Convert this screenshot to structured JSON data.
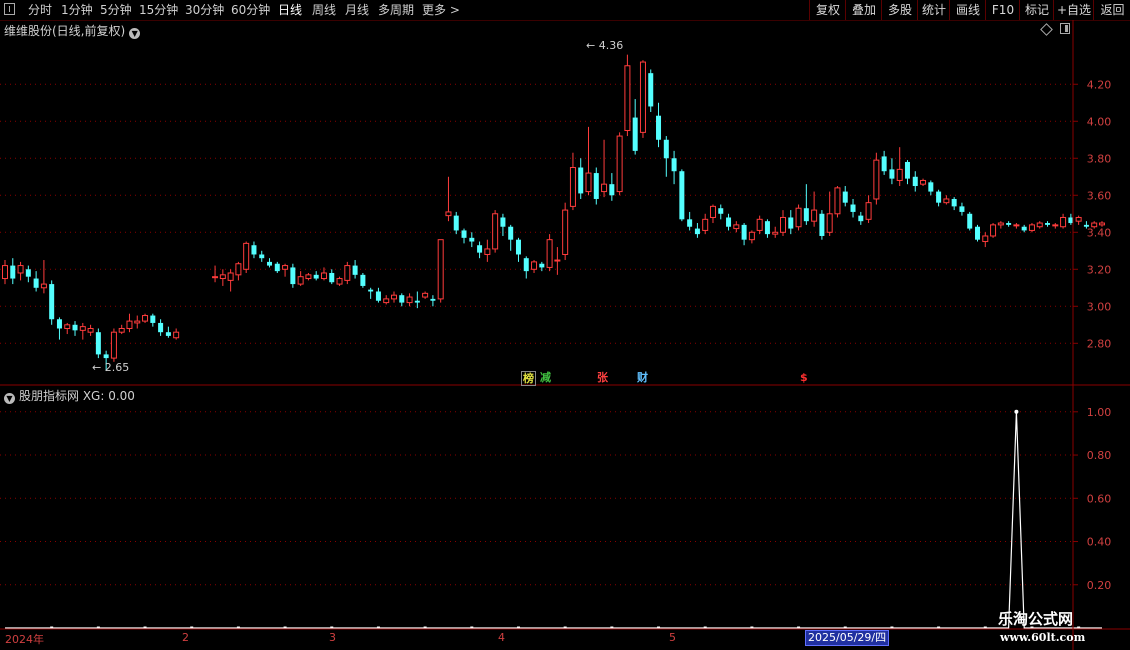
{
  "toolbar": {
    "periods": [
      {
        "label": "分时",
        "x": 0
      },
      {
        "label": "1分钟"
      },
      {
        "label": "5分钟"
      },
      {
        "label": "15分钟"
      },
      {
        "label": "30分钟"
      },
      {
        "label": "60分钟"
      },
      {
        "label": "日线"
      },
      {
        "label": "周线"
      },
      {
        "label": "月线"
      },
      {
        "label": "多周期"
      },
      {
        "label": "更多 >"
      }
    ],
    "active_period": "日线",
    "right_buttons": [
      "复权",
      "叠加",
      "多股",
      "统计",
      "画线",
      "F10",
      "标记",
      "+自选",
      "返回"
    ]
  },
  "main": {
    "title": "维维股份(日线,前复权)",
    "high_label": "4.36",
    "low_label": "2.65",
    "tags": [
      {
        "text": "榜",
        "color": "#e0e040"
      },
      {
        "text": "减",
        "color": "#40c040"
      },
      {
        "text": "张",
        "color": "#ff4040"
      },
      {
        "text": "财",
        "color": "#60c0ff"
      },
      {
        "text": "$",
        "color": "#ff3030"
      }
    ]
  },
  "indicator": {
    "title": "股朋指标网 XG: 0.00"
  },
  "dates": {
    "year": "2024年",
    "months": [
      "2",
      "3",
      "4",
      "5"
    ],
    "selected": "2025/05/29/四"
  },
  "watermark": {
    "title": "乐淘公式网",
    "url": "www.60lt.com"
  },
  "colors": {
    "up": "#ff3c3c",
    "down": "#54ffff",
    "grid": "#8a0000",
    "axis_text": "#d04040",
    "signal_line": "#ffffff"
  },
  "chart_data": [
    {
      "type": "candlestick",
      "title": "维维股份(日线,前复权)",
      "y_ticks": [
        2.8,
        3.0,
        3.2,
        3.4,
        3.6,
        3.8,
        4.0,
        4.2
      ],
      "ylim": [
        2.58,
        4.45
      ],
      "candles": [
        [
          3.15,
          3.22,
          3.25,
          3.12
        ],
        [
          3.22,
          3.15,
          3.26,
          3.12
        ],
        [
          3.18,
          3.22,
          3.24,
          3.14
        ],
        [
          3.2,
          3.16,
          3.22,
          3.13
        ],
        [
          3.15,
          3.1,
          3.19,
          3.08
        ],
        [
          3.1,
          3.12,
          3.25,
          3.07
        ],
        [
          3.12,
          2.93,
          3.14,
          2.9
        ],
        [
          2.93,
          2.88,
          2.94,
          2.82
        ],
        [
          2.88,
          2.9,
          2.91,
          2.85
        ],
        [
          2.9,
          2.87,
          2.92,
          2.84
        ],
        [
          2.87,
          2.89,
          2.91,
          2.82
        ],
        [
          2.86,
          2.88,
          2.9,
          2.84
        ],
        [
          2.86,
          2.74,
          2.88,
          2.72
        ],
        [
          2.74,
          2.72,
          2.76,
          2.65
        ],
        [
          2.72,
          2.86,
          2.88,
          2.7
        ],
        [
          2.86,
          2.88,
          2.9,
          2.85
        ],
        [
          2.88,
          2.92,
          2.96,
          2.86
        ],
        [
          2.91,
          2.92,
          2.95,
          2.88
        ],
        [
          2.92,
          2.95,
          2.96,
          2.91
        ],
        [
          2.95,
          2.91,
          2.96,
          2.89
        ],
        [
          2.91,
          2.86,
          2.93,
          2.84
        ],
        [
          2.86,
          2.84,
          2.89,
          2.83
        ],
        [
          2.83,
          2.86,
          2.88,
          2.82
        ],
        null,
        null,
        null,
        null,
        [
          3.16,
          3.16,
          3.22,
          3.13
        ],
        [
          3.15,
          3.17,
          3.2,
          3.11
        ],
        [
          3.14,
          3.18,
          3.2,
          3.08
        ],
        [
          3.17,
          3.23,
          3.24,
          3.14
        ],
        [
          3.2,
          3.34,
          3.35,
          3.18
        ],
        [
          3.33,
          3.28,
          3.35,
          3.26
        ],
        [
          3.28,
          3.26,
          3.3,
          3.24
        ],
        [
          3.24,
          3.22,
          3.26,
          3.21
        ],
        [
          3.23,
          3.19,
          3.24,
          3.18
        ],
        [
          3.2,
          3.22,
          3.23,
          3.16
        ],
        [
          3.21,
          3.12,
          3.23,
          3.1
        ],
        [
          3.12,
          3.16,
          3.19,
          3.11
        ],
        [
          3.15,
          3.17,
          3.18,
          3.14
        ],
        [
          3.17,
          3.15,
          3.19,
          3.14
        ],
        [
          3.15,
          3.18,
          3.21,
          3.14
        ],
        [
          3.18,
          3.13,
          3.2,
          3.12
        ],
        [
          3.12,
          3.15,
          3.16,
          3.11
        ],
        [
          3.14,
          3.22,
          3.24,
          3.12
        ],
        [
          3.22,
          3.17,
          3.25,
          3.15
        ],
        [
          3.17,
          3.11,
          3.18,
          3.1
        ],
        [
          3.09,
          3.08,
          3.1,
          3.04
        ],
        [
          3.08,
          3.03,
          3.1,
          3.02
        ],
        [
          3.02,
          3.04,
          3.06,
          3.01
        ],
        [
          3.04,
          3.06,
          3.08,
          3.02
        ],
        [
          3.06,
          3.02,
          3.07,
          3.0
        ],
        [
          3.02,
          3.05,
          3.07,
          3.0
        ],
        [
          3.03,
          3.02,
          3.08,
          2.99
        ],
        [
          3.05,
          3.07,
          3.08,
          3.04
        ],
        [
          3.04,
          3.03,
          3.06,
          3.0
        ],
        [
          3.04,
          3.36,
          3.36,
          3.02
        ],
        [
          3.49,
          3.51,
          3.7,
          3.46
        ],
        [
          3.49,
          3.41,
          3.51,
          3.39
        ],
        [
          3.41,
          3.37,
          3.42,
          3.34
        ],
        [
          3.37,
          3.35,
          3.4,
          3.32
        ],
        [
          3.33,
          3.29,
          3.35,
          3.26
        ],
        [
          3.28,
          3.31,
          3.36,
          3.24
        ],
        [
          3.31,
          3.5,
          3.52,
          3.29
        ],
        [
          3.48,
          3.43,
          3.5,
          3.38
        ],
        [
          3.43,
          3.36,
          3.44,
          3.3
        ],
        [
          3.36,
          3.28,
          3.37,
          3.24
        ],
        [
          3.26,
          3.19,
          3.27,
          3.15
        ],
        [
          3.2,
          3.24,
          3.25,
          3.18
        ],
        [
          3.23,
          3.21,
          3.24,
          3.19
        ],
        [
          3.21,
          3.36,
          3.39,
          3.19
        ],
        [
          3.25,
          3.25,
          3.32,
          3.17
        ],
        [
          3.28,
          3.52,
          3.56,
          3.25
        ],
        [
          3.54,
          3.75,
          3.83,
          3.52
        ],
        [
          3.75,
          3.61,
          3.8,
          3.58
        ],
        [
          3.62,
          3.72,
          3.97,
          3.6
        ],
        [
          3.72,
          3.58,
          3.75,
          3.55
        ],
        [
          3.62,
          3.66,
          3.9,
          3.59
        ],
        [
          3.66,
          3.6,
          3.72,
          3.57
        ],
        [
          3.62,
          3.92,
          3.94,
          3.6
        ],
        [
          3.95,
          4.3,
          4.36,
          3.92
        ],
        [
          4.02,
          3.84,
          4.12,
          3.82
        ],
        [
          3.94,
          4.32,
          4.33,
          3.91
        ],
        [
          4.26,
          4.08,
          4.28,
          4.05
        ],
        [
          4.03,
          3.9,
          4.1,
          3.86
        ],
        [
          3.9,
          3.8,
          3.92,
          3.7
        ],
        [
          3.8,
          3.73,
          3.84,
          3.66
        ],
        [
          3.73,
          3.47,
          3.74,
          3.46
        ],
        [
          3.47,
          3.43,
          3.51,
          3.41
        ],
        [
          3.42,
          3.39,
          3.45,
          3.37
        ],
        [
          3.41,
          3.47,
          3.5,
          3.39
        ],
        [
          3.48,
          3.54,
          3.55,
          3.45
        ],
        [
          3.53,
          3.5,
          3.55,
          3.47
        ],
        [
          3.48,
          3.43,
          3.5,
          3.41
        ],
        [
          3.42,
          3.44,
          3.46,
          3.4
        ],
        [
          3.44,
          3.36,
          3.45,
          3.33
        ],
        [
          3.36,
          3.4,
          3.41,
          3.34
        ],
        [
          3.41,
          3.47,
          3.49,
          3.39
        ],
        [
          3.46,
          3.39,
          3.47,
          3.37
        ],
        [
          3.39,
          3.4,
          3.43,
          3.37
        ],
        [
          3.4,
          3.48,
          3.52,
          3.38
        ],
        [
          3.48,
          3.42,
          3.52,
          3.39
        ],
        [
          3.43,
          3.53,
          3.55,
          3.41
        ],
        [
          3.53,
          3.46,
          3.66,
          3.44
        ],
        [
          3.46,
          3.52,
          3.62,
          3.43
        ],
        [
          3.5,
          3.38,
          3.52,
          3.36
        ],
        [
          3.4,
          3.5,
          3.62,
          3.38
        ],
        [
          3.5,
          3.64,
          3.65,
          3.48
        ],
        [
          3.62,
          3.56,
          3.65,
          3.54
        ],
        [
          3.55,
          3.51,
          3.58,
          3.48
        ],
        [
          3.49,
          3.46,
          3.51,
          3.44
        ],
        [
          3.47,
          3.56,
          3.6,
          3.45
        ],
        [
          3.58,
          3.79,
          3.83,
          3.55
        ],
        [
          3.81,
          3.73,
          3.84,
          3.71
        ],
        [
          3.74,
          3.69,
          3.8,
          3.66
        ],
        [
          3.68,
          3.74,
          3.86,
          3.65
        ],
        [
          3.78,
          3.69,
          3.79,
          3.66
        ],
        [
          3.7,
          3.65,
          3.73,
          3.62
        ],
        [
          3.66,
          3.68,
          3.69,
          3.65
        ],
        [
          3.67,
          3.62,
          3.68,
          3.6
        ],
        [
          3.62,
          3.56,
          3.63,
          3.54
        ],
        [
          3.56,
          3.58,
          3.6,
          3.55
        ],
        [
          3.58,
          3.54,
          3.59,
          3.52
        ],
        [
          3.54,
          3.51,
          3.56,
          3.49
        ],
        [
          3.5,
          3.42,
          3.51,
          3.41
        ],
        [
          3.43,
          3.36,
          3.44,
          3.35
        ],
        [
          3.35,
          3.38,
          3.4,
          3.32
        ],
        [
          3.38,
          3.44,
          3.45,
          3.37
        ],
        [
          3.44,
          3.45,
          3.46,
          3.42
        ],
        [
          3.45,
          3.44,
          3.46,
          3.43
        ],
        [
          3.44,
          3.44,
          3.45,
          3.42
        ],
        [
          3.43,
          3.41,
          3.44,
          3.4
        ],
        [
          3.41,
          3.44,
          3.45,
          3.4
        ],
        [
          3.43,
          3.45,
          3.46,
          3.42
        ],
        [
          3.45,
          3.44,
          3.46,
          3.43
        ],
        [
          3.44,
          3.44,
          3.45,
          3.42
        ],
        [
          3.43,
          3.48,
          3.5,
          3.42
        ],
        [
          3.48,
          3.45,
          3.5,
          3.44
        ],
        [
          3.46,
          3.48,
          3.49,
          3.44
        ],
        [
          3.44,
          3.43,
          3.46,
          3.42
        ],
        [
          3.43,
          3.45,
          3.46,
          3.42
        ],
        [
          3.44,
          3.45,
          3.46,
          3.43
        ]
      ]
    },
    {
      "type": "line",
      "title": "股朋指标网 XG: 0.00",
      "series": [
        {
          "name": "XG",
          "signal_index": 130,
          "value_on": 1.0,
          "value_off": 0.0
        }
      ],
      "y_ticks": [
        0.2,
        0.4,
        0.6,
        0.8,
        1.0
      ],
      "ylim": [
        0,
        1.05
      ]
    }
  ]
}
